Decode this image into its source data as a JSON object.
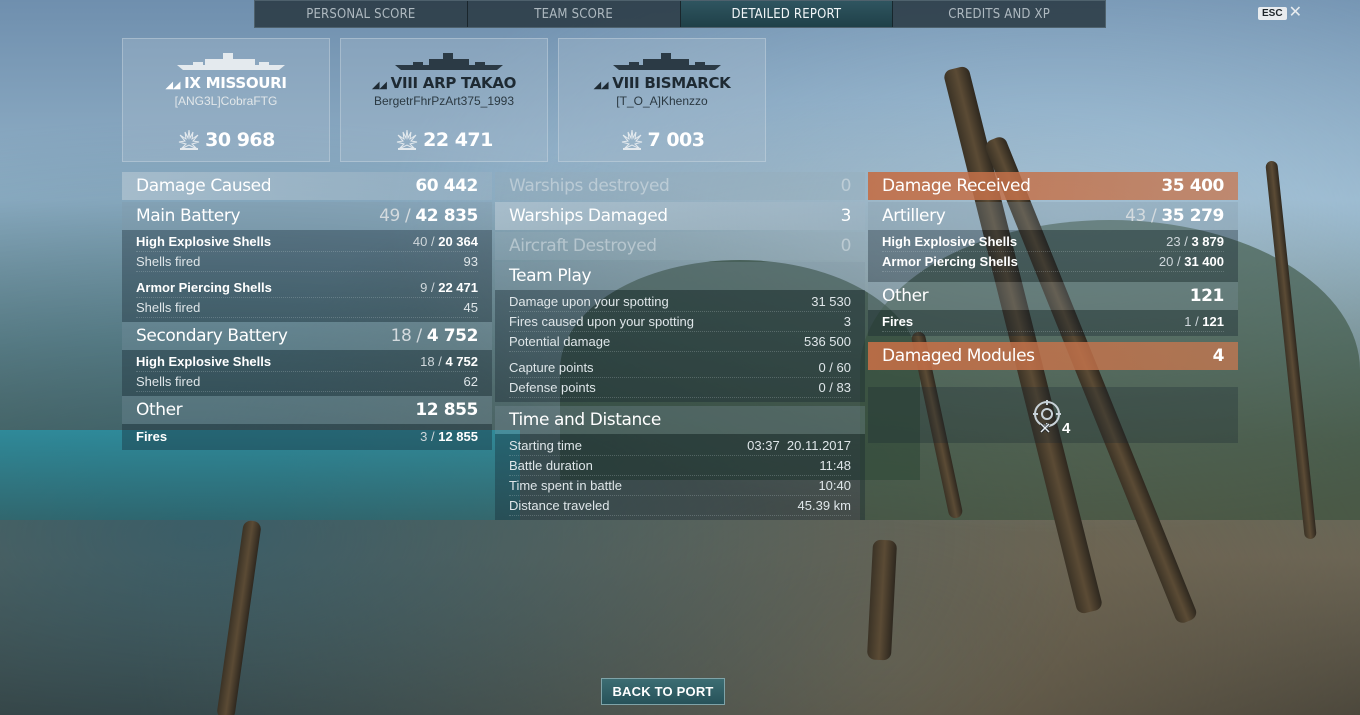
{
  "tabs": [
    {
      "label": "PERSONAL SCORE",
      "active": false
    },
    {
      "label": "TEAM SCORE",
      "active": false
    },
    {
      "label": "DETAILED REPORT",
      "active": true
    },
    {
      "label": "CREDITS AND XP",
      "active": false
    }
  ],
  "esc_label": "ESC",
  "ships": [
    {
      "tier": "IX",
      "name": "MISSOURI",
      "player": "[ANG3L]CobraFTG",
      "score": "30 968"
    },
    {
      "tier": "VIII",
      "name": "ARP TAKAO",
      "player": "BergetrFhrPzArt375_1993",
      "score": "22 471"
    },
    {
      "tier": "VIII",
      "name": "BISMARCK",
      "player": "[T_O_A]Khenzzo",
      "score": "7 003"
    }
  ],
  "left": {
    "damage_caused": {
      "label": "Damage Caused",
      "value": "60 442"
    },
    "main_battery": {
      "label": "Main Battery",
      "hits": "49",
      "damage": "42 835"
    },
    "mb_he": {
      "label": "High Explosive Shells",
      "hits": "40",
      "damage": "20 364"
    },
    "mb_he_fired": {
      "label": "Shells fired",
      "value": "93"
    },
    "mb_ap": {
      "label": "Armor Piercing Shells",
      "hits": "9",
      "damage": "22 471"
    },
    "mb_ap_fired": {
      "label": "Shells fired",
      "value": "45"
    },
    "secondary": {
      "label": "Secondary Battery",
      "hits": "18",
      "damage": "4 752"
    },
    "sec_he": {
      "label": "High Explosive Shells",
      "hits": "18",
      "damage": "4 752"
    },
    "sec_he_fired": {
      "label": "Shells fired",
      "value": "62"
    },
    "other": {
      "label": "Other",
      "value": "12 855"
    },
    "fires": {
      "label": "Fires",
      "hits": "3",
      "damage": "12 855"
    }
  },
  "middle": {
    "warships_destroyed": {
      "label": "Warships destroyed",
      "value": "0"
    },
    "warships_damaged": {
      "label": "Warships Damaged",
      "value": "3"
    },
    "aircraft_destroyed": {
      "label": "Aircraft Destroyed",
      "value": "0"
    },
    "team_play": {
      "label": "Team Play"
    },
    "damage_spotting": {
      "label": "Damage upon your spotting",
      "value": "31 530"
    },
    "fires_spotting": {
      "label": "Fires caused upon your spotting",
      "value": "3"
    },
    "potential_damage": {
      "label": "Potential damage",
      "value": "536 500"
    },
    "capture_points": {
      "label": "Capture points",
      "value": "0 / 60"
    },
    "defense_points": {
      "label": "Defense points",
      "value": "0 / 83"
    },
    "time_distance": {
      "label": "Time and Distance"
    },
    "starting_time": {
      "label": "Starting time",
      "value": "03:37  20.11.2017"
    },
    "battle_duration": {
      "label": "Battle duration",
      "value": "11:48"
    },
    "time_spent": {
      "label": "Time spent in battle",
      "value": "10:40"
    },
    "distance": {
      "label": "Distance traveled",
      "value": "45.39 km"
    }
  },
  "right": {
    "damage_received": {
      "label": "Damage Received",
      "value": "35 400"
    },
    "artillery": {
      "label": "Artillery",
      "hits": "43",
      "damage": "35 279"
    },
    "art_he": {
      "label": "High Explosive Shells",
      "hits": "23",
      "damage": "3 879"
    },
    "art_ap": {
      "label": "Armor Piercing Shells",
      "hits": "20",
      "damage": "31 400"
    },
    "other": {
      "label": "Other",
      "value": "121"
    },
    "fires": {
      "label": "Fires",
      "hits": "1",
      "damage": "121"
    },
    "damaged_modules": {
      "label": "Damaged Modules",
      "value": "4"
    },
    "module_count": "4"
  },
  "back_button": "BACK TO PORT",
  "colors": {
    "accent_orange": "#c46e46",
    "active_tab": "#2f5560",
    "button": "#3c6d73"
  },
  "icons": [
    "ship-silhouette-icon",
    "damage-burst-icon",
    "damaged-module-icon",
    "close-icon"
  ]
}
